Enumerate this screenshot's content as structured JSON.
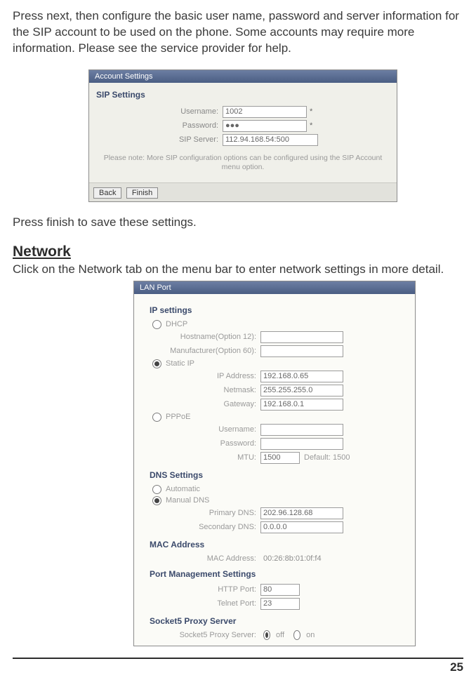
{
  "copy": {
    "intro": "Press next, then configure the basic user name, password and server information for the SIP account to be used on the phone.  Some accounts may require more information.  Please see the service provider for help.",
    "after_shot1": "Press finish to save these settings.",
    "network_heading": "Network",
    "network_desc": "Click on the Network tab on the menu bar to enter network settings in more detail."
  },
  "account_settings": {
    "title": "Account Settings",
    "section": "SIP Settings",
    "fields": {
      "username": {
        "label": "Username:",
        "value": "1002",
        "star": "*"
      },
      "password": {
        "label": "Password:",
        "value": "●●●",
        "star": "*"
      },
      "sip_server": {
        "label": "SIP Server:",
        "value": "112.94.168.54:500",
        "star": ""
      }
    },
    "note": "Please note: More SIP configuration options can be configured using the SIP Account menu option.",
    "buttons": {
      "back": "Back",
      "finish": "Finish"
    }
  },
  "lan_port": {
    "title": "LAN Port",
    "ip_section": "IP settings",
    "modes": {
      "dhcp": "DHCP",
      "static": "Static IP",
      "pppoe": "PPPoE"
    },
    "dhcp_fields": {
      "hostname": {
        "label": "Hostname(Option 12):",
        "value": ""
      },
      "manufacturer": {
        "label": "Manufacturer(Option 60):",
        "value": ""
      }
    },
    "static_fields": {
      "ip": {
        "label": "IP Address:",
        "value": "192.168.0.65"
      },
      "netmask": {
        "label": "Netmask:",
        "value": "255.255.255.0"
      },
      "gateway": {
        "label": "Gateway:",
        "value": "192.168.0.1"
      }
    },
    "pppoe_fields": {
      "user": {
        "label": "Username:",
        "value": ""
      },
      "pass": {
        "label": "Password:",
        "value": ""
      },
      "mtu": {
        "label": "MTU:",
        "value": "1500",
        "after": "Default: 1500"
      }
    },
    "dns_section": "DNS Settings",
    "dns_modes": {
      "auto": "Automatic",
      "manual": "Manual DNS"
    },
    "dns_fields": {
      "primary": {
        "label": "Primary DNS:",
        "value": "202.96.128.68"
      },
      "secondary": {
        "label": "Secondary DNS:",
        "value": "0.0.0.0"
      }
    },
    "mac_section": "MAC Address",
    "mac": {
      "label": "MAC Address:",
      "value": "00:26:8b:01:0f:f4"
    },
    "port_section": "Port Management Settings",
    "port_fields": {
      "http": {
        "label": "HTTP Port:",
        "value": "80"
      },
      "telnet": {
        "label": "Telnet Port:",
        "value": "23"
      }
    },
    "proxy_section": "Socket5 Proxy Server",
    "proxy": {
      "label": "Socket5 Proxy Server:",
      "off": "off",
      "on": "on"
    }
  },
  "footer": {
    "page": "25"
  }
}
